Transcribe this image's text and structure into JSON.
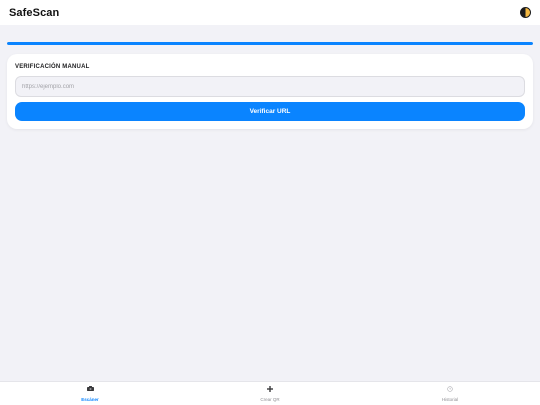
{
  "header": {
    "title": "SafeScan",
    "theme_icon": "half-moon-icon"
  },
  "progress": {
    "percent": 100,
    "color": "#0a84ff"
  },
  "manual_check": {
    "title": "VERIFICACIÓN MANUAL",
    "input_value": "",
    "input_placeholder": "https://ejemplo.com",
    "button_label": "Verificar URL"
  },
  "tabs": [
    {
      "label": "Escáner",
      "icon": "camera-icon",
      "active": true
    },
    {
      "label": "Crear QR",
      "icon": "plus-icon",
      "active": false
    },
    {
      "label": "Historial",
      "icon": "clock-icon",
      "active": false
    }
  ],
  "colors": {
    "accent": "#0a84ff",
    "background": "#f2f2f7",
    "surface": "#ffffff"
  }
}
